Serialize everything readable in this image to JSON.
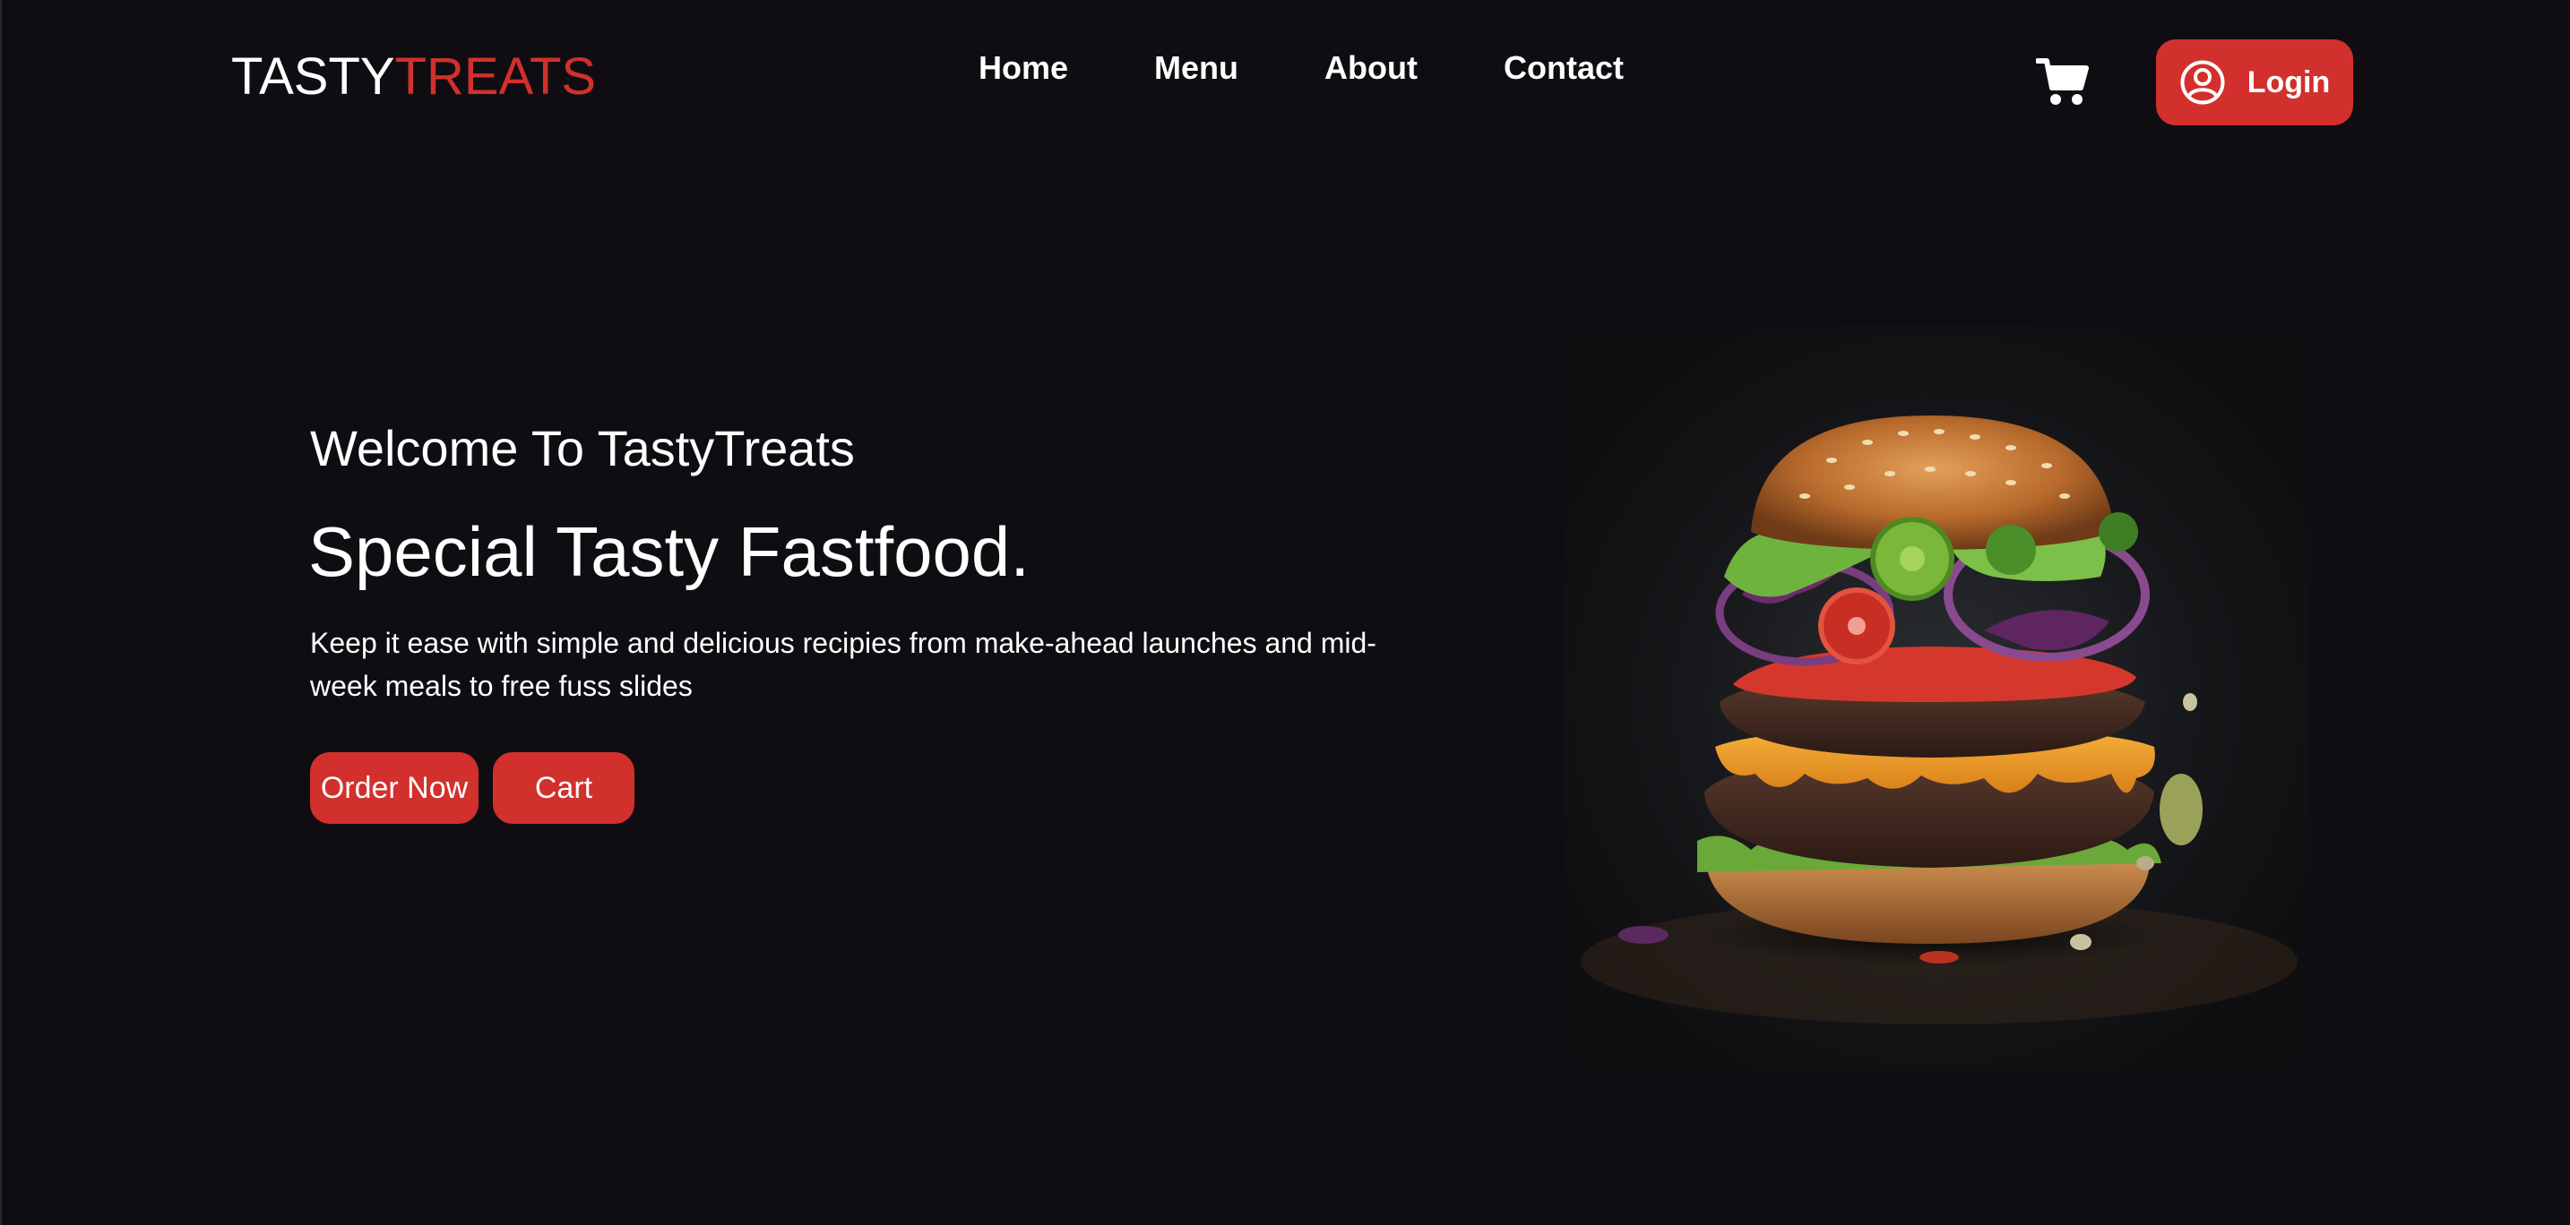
{
  "header": {
    "logo_part1": "TASTY",
    "logo_part2": "TREATS",
    "nav": [
      {
        "label": "Home"
      },
      {
        "label": "Menu"
      },
      {
        "label": "About"
      },
      {
        "label": "Contact"
      }
    ],
    "cart_icon": "shopping-cart-icon",
    "login_icon": "user-circle-icon",
    "login_label": "Login"
  },
  "hero": {
    "subtitle": "Welcome To TastyTreats",
    "title": "Special Tasty Fastfood.",
    "description": "Keep it ease with simple and delicious recipies from make-ahead launches and mid-week meals to free fuss slides",
    "buttons": {
      "order_label": "Order Now",
      "cart_label": "Cart"
    },
    "image_subject": "burger-image"
  },
  "colors": {
    "background": "#100d12",
    "accent": "#d2302c",
    "text": "#ffffff"
  }
}
